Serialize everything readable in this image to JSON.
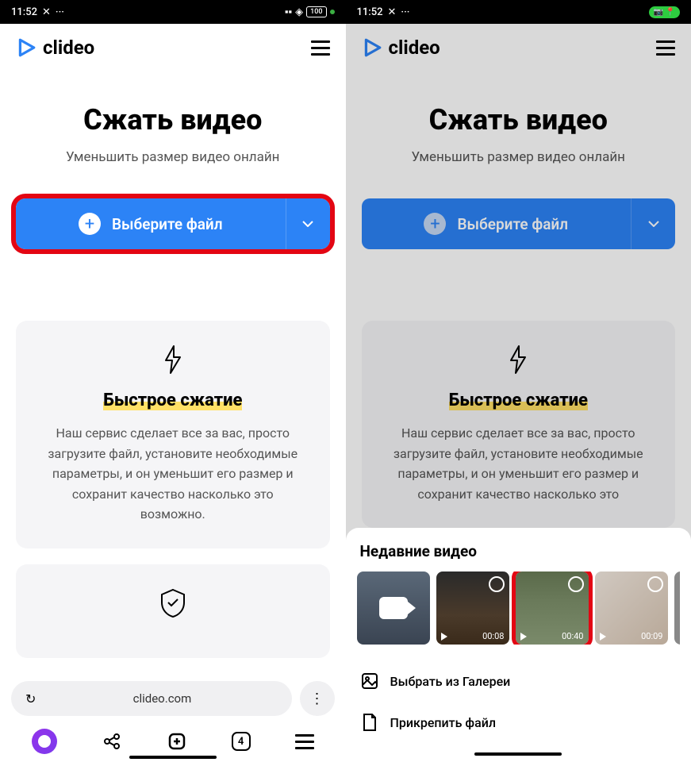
{
  "status": {
    "time": "11:52",
    "battery": "100"
  },
  "logo": "clideo",
  "page": {
    "title": "Сжать видео",
    "subtitle": "Уменьшить размер видео онлайн",
    "upload_label": "Выберите файл"
  },
  "feature": {
    "title": "Быстрое сжатие",
    "desc_full": "Наш сервис сделает все за вас, просто загрузите файл, установите необходимые параметры, и он уменьшит его размер и сохранит качество насколько это возможно.",
    "desc_cut": "Наш сервис сделает все за вас, просто загрузите файл, установите необходимые параметры, и он уменьшит его размер и сохранит качество насколько это"
  },
  "browser": {
    "url": "clideo.com",
    "tabs": "4"
  },
  "sheet": {
    "title": "Недавние видео",
    "thumbs": [
      {
        "duration": "00:08"
      },
      {
        "duration": "00:40"
      },
      {
        "duration": "00:09"
      }
    ],
    "gallery": "Выбрать из Галереи",
    "attach": "Прикрепить файл"
  }
}
